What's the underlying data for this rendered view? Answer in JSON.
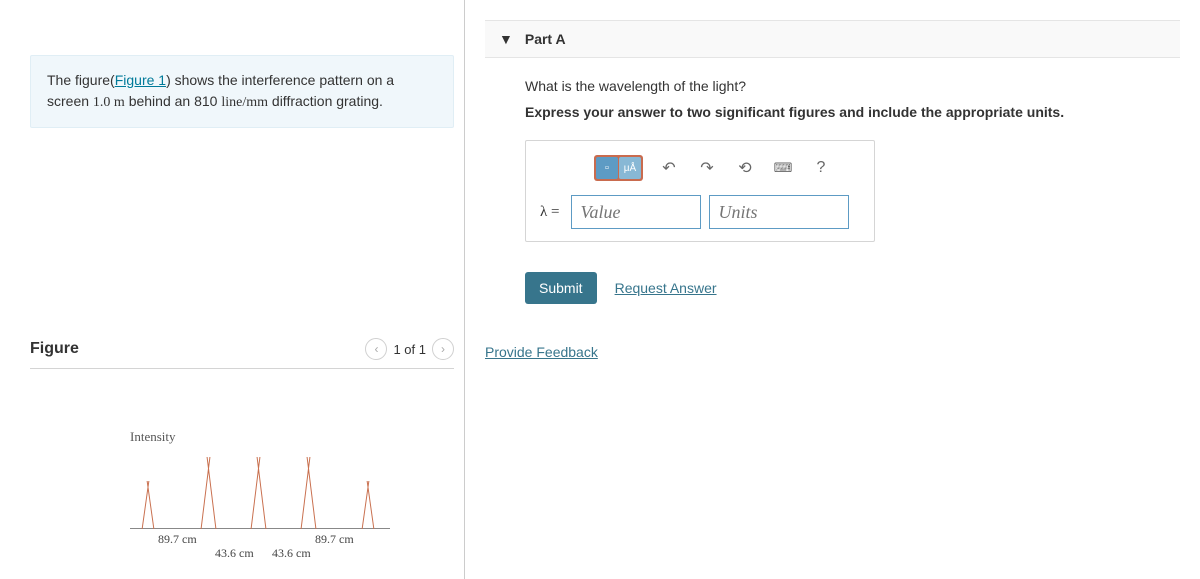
{
  "intro": {
    "prefix": "The figure(",
    "link_text": "Figure 1",
    "mid": ") shows the interference pattern on a screen ",
    "val1": "1.0 m",
    "mid2": " behind an 810 ",
    "val2": "line/mm",
    "suffix": " diffraction grating."
  },
  "figure": {
    "title": "Figure",
    "pager": "1 of 1",
    "intensity_label": "Intensity",
    "m89a": "89.7 cm",
    "m89b": "89.7 cm",
    "m43a": "43.6 cm",
    "m43b": "43.6 cm"
  },
  "part": {
    "label": "Part A",
    "question": "What is the wavelength of the light?",
    "instruction": "Express your answer to two significant figures and include the appropriate units.",
    "lambda": "λ =",
    "value_placeholder": "Value",
    "units_placeholder": "Units",
    "submit": "Submit",
    "request": "Request Answer",
    "help_q": "?",
    "units_hint": "μÅ"
  },
  "feedback": "Provide Feedback"
}
